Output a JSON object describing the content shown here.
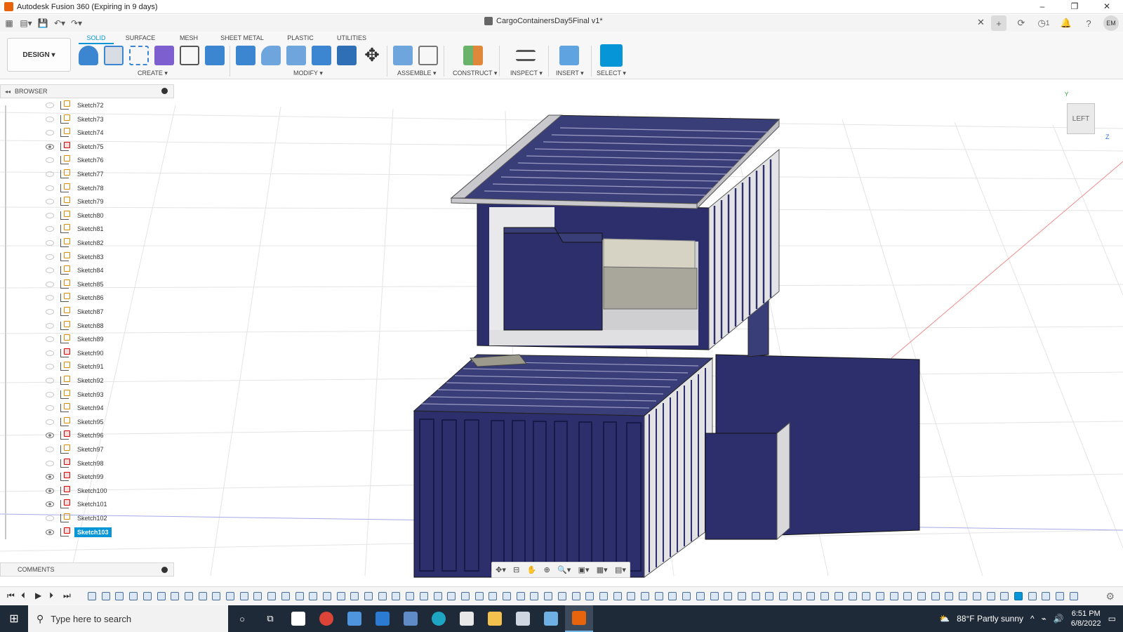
{
  "window": {
    "title": "Autodesk Fusion 360 (Expiring in 9 days)",
    "controls": {
      "minimize": "–",
      "restore": "❐",
      "close": "✕"
    }
  },
  "quick_access": {
    "document_title": "CargoContainersDay5Final v1*",
    "job_count": "1",
    "user_initials": "EM"
  },
  "toolbar": {
    "workspace": "DESIGN ▾",
    "tabs": [
      "SOLID",
      "SURFACE",
      "MESH",
      "SHEET METAL",
      "PLASTIC",
      "UTILITIES"
    ],
    "active_tab": "SOLID",
    "groups": {
      "create": "CREATE ▾",
      "modify": "MODIFY ▾",
      "assemble": "ASSEMBLE ▾",
      "construct": "CONSTRUCT ▾",
      "inspect": "INSPECT ▾",
      "insert": "INSERT ▾",
      "select": "SELECT ▾"
    }
  },
  "browser": {
    "title": "BROWSER",
    "items": [
      {
        "label": "Sketch72",
        "visible": false,
        "flag": "normal"
      },
      {
        "label": "Sketch73",
        "visible": false,
        "flag": "normal"
      },
      {
        "label": "Sketch74",
        "visible": false,
        "flag": "normal"
      },
      {
        "label": "Sketch75",
        "visible": true,
        "flag": "red"
      },
      {
        "label": "Sketch76",
        "visible": false,
        "flag": "normal"
      },
      {
        "label": "Sketch77",
        "visible": false,
        "flag": "normal"
      },
      {
        "label": "Sketch78",
        "visible": false,
        "flag": "normal"
      },
      {
        "label": "Sketch79",
        "visible": false,
        "flag": "normal"
      },
      {
        "label": "Sketch80",
        "visible": false,
        "flag": "normal"
      },
      {
        "label": "Sketch81",
        "visible": false,
        "flag": "normal"
      },
      {
        "label": "Sketch82",
        "visible": false,
        "flag": "normal"
      },
      {
        "label": "Sketch83",
        "visible": false,
        "flag": "normal"
      },
      {
        "label": "Sketch84",
        "visible": false,
        "flag": "normal"
      },
      {
        "label": "Sketch85",
        "visible": false,
        "flag": "normal"
      },
      {
        "label": "Sketch86",
        "visible": false,
        "flag": "normal"
      },
      {
        "label": "Sketch87",
        "visible": false,
        "flag": "normal"
      },
      {
        "label": "Sketch88",
        "visible": false,
        "flag": "normal"
      },
      {
        "label": "Sketch89",
        "visible": false,
        "flag": "normal"
      },
      {
        "label": "Sketch90",
        "visible": false,
        "flag": "red"
      },
      {
        "label": "Sketch91",
        "visible": false,
        "flag": "normal"
      },
      {
        "label": "Sketch92",
        "visible": false,
        "flag": "normal"
      },
      {
        "label": "Sketch93",
        "visible": false,
        "flag": "normal"
      },
      {
        "label": "Sketch94",
        "visible": false,
        "flag": "normal"
      },
      {
        "label": "Sketch95",
        "visible": false,
        "flag": "normal"
      },
      {
        "label": "Sketch96",
        "visible": true,
        "flag": "red"
      },
      {
        "label": "Sketch97",
        "visible": false,
        "flag": "normal"
      },
      {
        "label": "Sketch98",
        "visible": false,
        "flag": "red"
      },
      {
        "label": "Sketch99",
        "visible": true,
        "flag": "red"
      },
      {
        "label": "Sketch100",
        "visible": true,
        "flag": "red"
      },
      {
        "label": "Sketch101",
        "visible": true,
        "flag": "red"
      },
      {
        "label": "Sketch102",
        "visible": false,
        "flag": "normal"
      },
      {
        "label": "Sketch103",
        "visible": true,
        "flag": "red",
        "selected": true
      }
    ]
  },
  "comments": {
    "title": "COMMENTS"
  },
  "viewcube": {
    "face": "LEFT",
    "axis_y": "Y",
    "axis_z": "Z"
  },
  "taskbar": {
    "search_placeholder": "Type here to search",
    "weather": "88°F  Partly sunny",
    "time": "6:51 PM",
    "date": "6/8/2022"
  },
  "colors": {
    "accent": "#0696d7",
    "container_navy": "#2b2f6b",
    "roof_gray": "#c9c9cd",
    "taskbar": "#1f2a38"
  }
}
